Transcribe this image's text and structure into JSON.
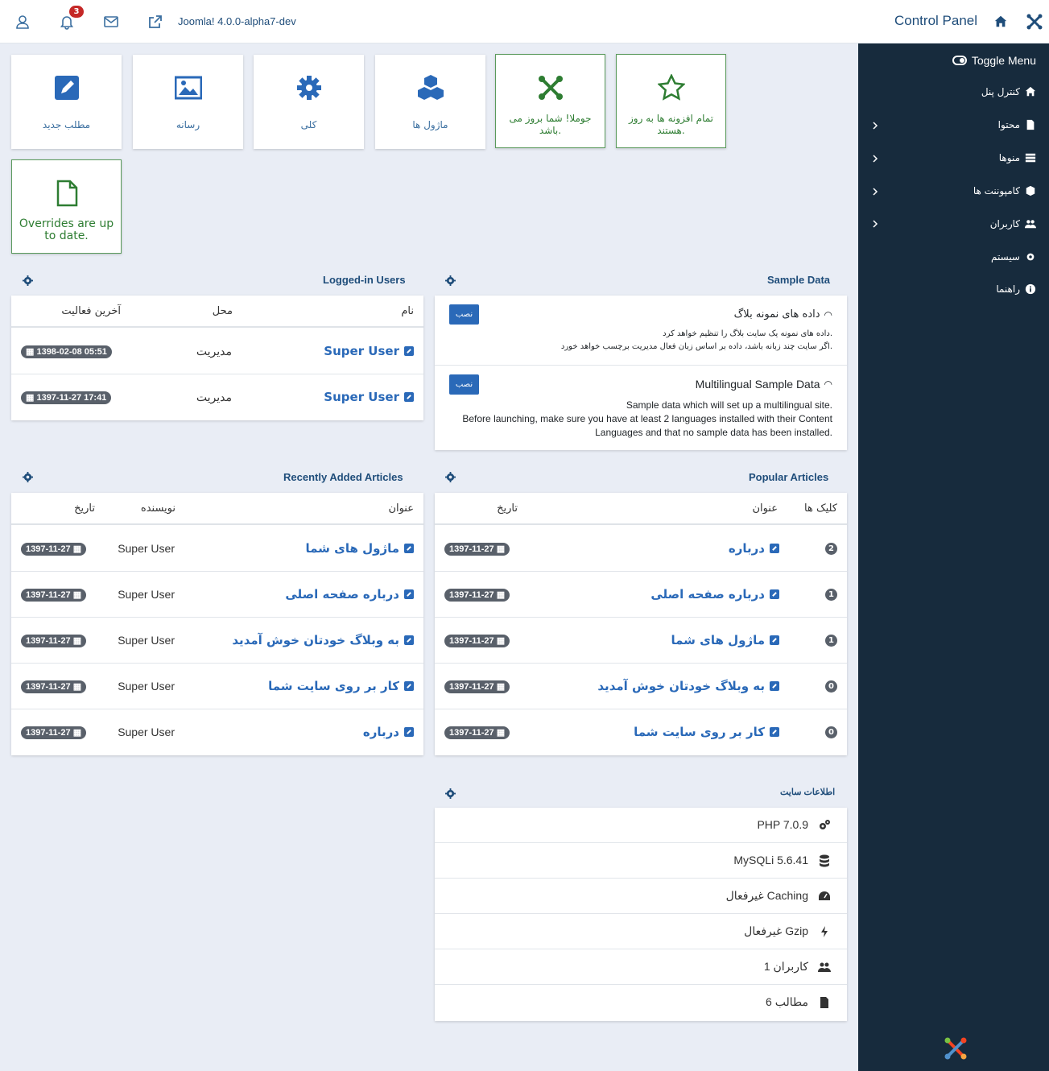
{
  "header": {
    "version": "Joomla! 4.0.0-alpha7-dev",
    "title": "Control Panel",
    "notification_count": "3"
  },
  "sidebar": {
    "toggle": "Toggle Menu",
    "items": [
      {
        "label": "کنترل پنل",
        "icon": "home-icon"
      },
      {
        "label": "محتوا",
        "icon": "file-icon"
      },
      {
        "label": "منوها",
        "icon": "list-icon"
      },
      {
        "label": "کامپوننت ها",
        "icon": "cube-icon"
      },
      {
        "label": "کاربران",
        "icon": "users-icon"
      },
      {
        "label": "سیستم",
        "icon": "gear-icon"
      },
      {
        "label": "راهنما",
        "icon": "info-icon"
      }
    ]
  },
  "tiles": [
    {
      "label": "مطلب جدید",
      "icon": "pencil-icon"
    },
    {
      "label": "رسانه",
      "icon": "image-icon"
    },
    {
      "label": "کلی",
      "icon": "gear-icon"
    },
    {
      "label": "ماژول ها",
      "icon": "cubes-icon"
    },
    {
      "label": "جوملا! شما بروز می باشد.",
      "icon": "joomla-icon"
    },
    {
      "label": "تمام افزونه ها به روز هستند.",
      "icon": "star-icon"
    },
    {
      "label": "Overrides are up to date.",
      "icon": "file-icon"
    }
  ],
  "logged_users": {
    "title": "Logged-in Users",
    "col_name": "نام",
    "col_location": "محل",
    "col_last": "آخرین فعالیت",
    "rows": [
      {
        "name": "Super User",
        "location": "مدیریت",
        "date": "1398-02-08 05:51"
      },
      {
        "name": "Super User",
        "location": "مدیریت",
        "date": "1397-11-27 17:41"
      }
    ]
  },
  "sample_data": {
    "title": "Sample Data",
    "install_label": "نصب",
    "items": [
      {
        "title": "داده های نمونه بلاگ",
        "lines": [
          "داده های نمونه یک سایت بلاگ را تنظیم خواهد کرد.",
          "اگر سایت چند زبانه باشد، داده بر اساس زبان فعال مدیریت برچسب خواهد خورد."
        ]
      },
      {
        "title": "Multilingual Sample Data",
        "lines": [
          "Sample data which will set up a multilingual site.",
          "Before launching, make sure you have at least 2 languages installed with their Content",
          "Languages and that no sample data has been installed."
        ]
      }
    ]
  },
  "recent": {
    "title": "Recently Added Articles",
    "col_title": "عنوان",
    "col_author": "نویسنده",
    "col_date": "تاریخ",
    "rows": [
      {
        "title": "ماژول های شما",
        "author": "Super User",
        "date": "1397-11-27"
      },
      {
        "title": "درباره صفحه اصلی",
        "author": "Super User",
        "date": "1397-11-27"
      },
      {
        "title": "به وبلاگ خودتان خوش آمدید",
        "author": "Super User",
        "date": "1397-11-27"
      },
      {
        "title": "کار بر روی سایت شما",
        "author": "Super User",
        "date": "1397-11-27"
      },
      {
        "title": "درباره",
        "author": "Super User",
        "date": "1397-11-27"
      }
    ]
  },
  "popular": {
    "title": "Popular Articles",
    "col_hits": "کلیک ها",
    "col_title": "عنوان",
    "col_date": "تاریخ",
    "rows": [
      {
        "hits": "2",
        "title": "درباره",
        "date": "1397-11-27"
      },
      {
        "hits": "1",
        "title": "درباره صفحه اصلی",
        "date": "1397-11-27"
      },
      {
        "hits": "1",
        "title": "ماژول های شما",
        "date": "1397-11-27"
      },
      {
        "hits": "0",
        "title": "به وبلاگ خودتان خوش آمدید",
        "date": "1397-11-27"
      },
      {
        "hits": "0",
        "title": "کار بر روی سایت شما",
        "date": "1397-11-27"
      }
    ]
  },
  "site_info": {
    "title": "اطلاعات سایت",
    "rows": [
      {
        "text": "PHP 7.0.9",
        "icon": "cogs-icon"
      },
      {
        "text": "MySQLi 5.6.41",
        "icon": "database-icon"
      },
      {
        "text": "Caching غیرفعال",
        "icon": "dashboard-icon"
      },
      {
        "text": "Gzip غیرفعال",
        "icon": "bolt-icon"
      },
      {
        "text": "کاربران 1",
        "icon": "users-icon"
      },
      {
        "text": "مطالب 6",
        "icon": "file-icon"
      }
    ]
  }
}
